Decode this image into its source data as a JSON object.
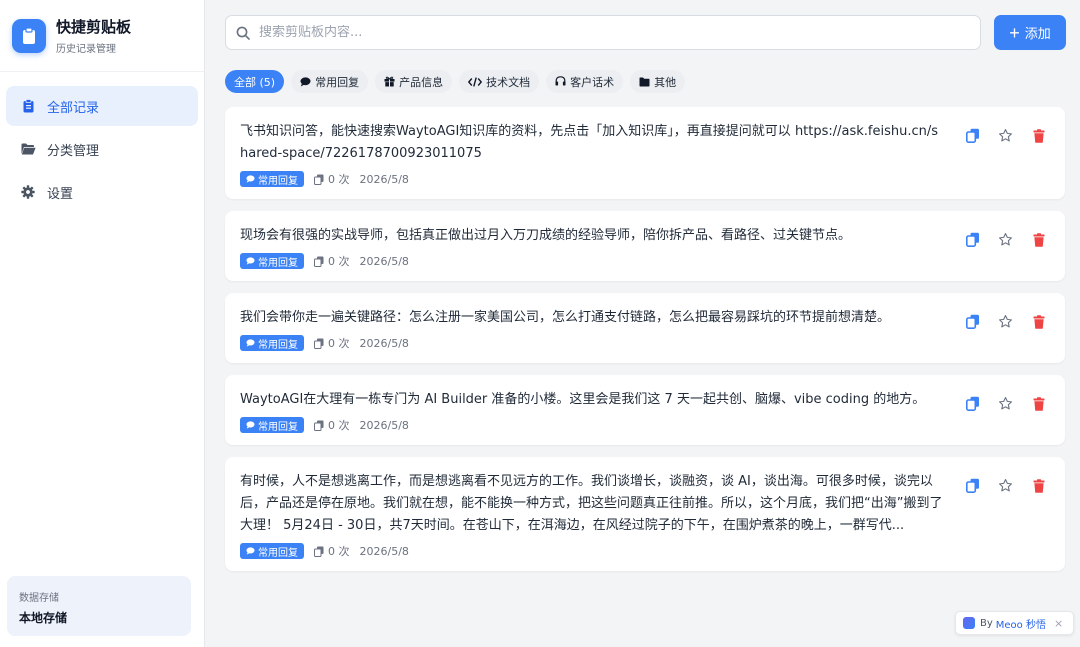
{
  "app": {
    "title": "快捷剪贴板",
    "subtitle": "历史记录管理"
  },
  "sidebar": {
    "items": [
      {
        "label": "全部记录",
        "icon": "clipboard-icon",
        "active": true
      },
      {
        "label": "分类管理",
        "icon": "folder-icon",
        "active": false
      },
      {
        "label": "设置",
        "icon": "gear-icon",
        "active": false
      }
    ],
    "storage": {
      "label": "数据存储",
      "value": "本地存储"
    }
  },
  "search": {
    "placeholder": "搜索剪贴板内容...",
    "value": ""
  },
  "toolbar": {
    "add_label": "添加"
  },
  "tabs": [
    {
      "label": "全部 (5)",
      "icon": "",
      "active": true
    },
    {
      "label": "常用回复",
      "icon": "chat-bubble-icon",
      "active": false
    },
    {
      "label": "产品信息",
      "icon": "gift-icon",
      "active": false
    },
    {
      "label": "技术文档",
      "icon": "code-icon",
      "active": false
    },
    {
      "label": "客户话术",
      "icon": "headset-icon",
      "active": false
    },
    {
      "label": "其他",
      "icon": "folder-icon",
      "active": false
    }
  ],
  "clips": [
    {
      "text": "飞书知识问答，能快速搜索WaytoAGI知识库的资料，先点击「加入知识库」，再直接提问就可以 https://ask.feishu.cn/shared-space/7226178700923011075",
      "category": "常用回复",
      "count": "0 次",
      "date": "2026/5/8"
    },
    {
      "text": "现场会有很强的实战导师，包括真正做出过月入万刀成绩的经验导师，陪你拆产品、看路径、过关键节点。",
      "category": "常用回复",
      "count": "0 次",
      "date": "2026/5/8"
    },
    {
      "text": "我们会带你走一遍关键路径：怎么注册一家美国公司，怎么打通支付链路，怎么把最容易踩坑的环节提前想清楚。",
      "category": "常用回复",
      "count": "0 次",
      "date": "2026/5/8"
    },
    {
      "text": "WaytoAGI在大理有一栋专门为 AI Builder 准备的小楼。这里会是我们这 7 天一起共创、脑爆、vibe coding 的地方。",
      "category": "常用回复",
      "count": "0 次",
      "date": "2026/5/8"
    },
    {
      "text": "有时候，人不是想逃离工作，而是想逃离看不见远方的工作。我们谈增长，谈融资，谈 AI，谈出海。可很多时候，谈完以后，产品还是停在原地。我们就在想，能不能换一种方式，把这些问题真正往前推。所以，这个月底，我们把“出海”搬到了大理！ 5月24日 - 30日，共7天时间。在苍山下，在洱海边，在风经过院子的下午，在围炉煮茶的晚上，一群写代...",
      "category": "常用回复",
      "count": "0 次",
      "date": "2026/5/8"
    }
  ],
  "footer": {
    "by": "By",
    "brand": "Meoo 秒悟",
    "close": "×"
  },
  "colors": {
    "accent": "#3b82f6",
    "danger": "#ef4444",
    "active_bg": "#e8f0fe"
  }
}
